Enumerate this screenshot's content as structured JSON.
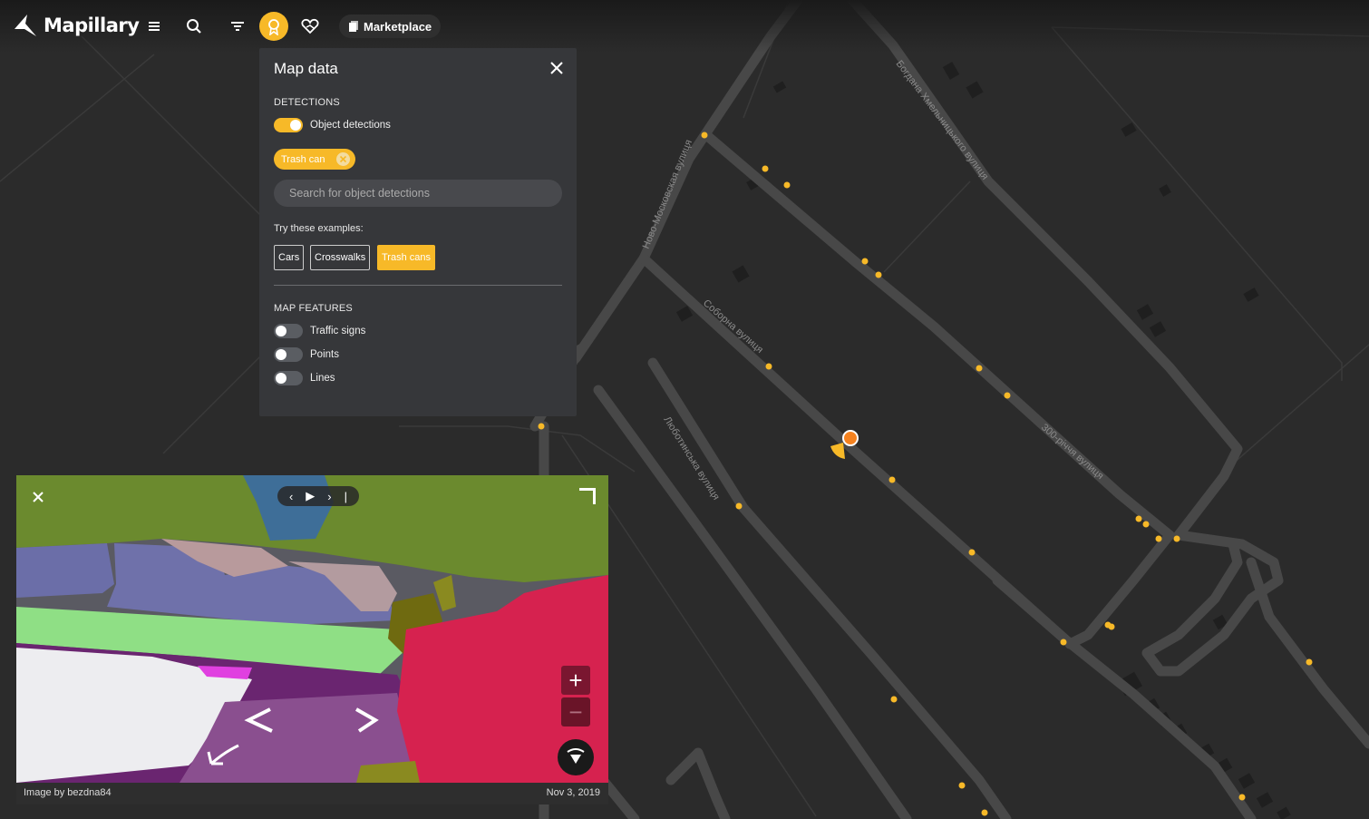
{
  "app": {
    "name": "Mapillary"
  },
  "toolbar": {
    "marketplace_label": "Marketplace"
  },
  "panel": {
    "title": "Map data",
    "detections_label": "DETECTIONS",
    "object_detections_label": "Object detections",
    "object_detections_on": true,
    "chip_label": "Trash can",
    "search_placeholder": "Search for object detections",
    "try_label": "Try these examples:",
    "examples": [
      "Cars",
      "Crosswalks",
      "Trash cans"
    ],
    "active_example": "Trash cans",
    "map_features_label": "MAP FEATURES",
    "features": [
      {
        "label": "Traffic signs",
        "on": false
      },
      {
        "label": "Points",
        "on": false
      },
      {
        "label": "Lines",
        "on": false
      }
    ]
  },
  "map": {
    "street_labels": [
      "Ново-Московская вулиця",
      "Богдана Хмельницького вулиця",
      "Соборна вулиця",
      "Люботинська вулиця",
      "300-річчя вулиця"
    ]
  },
  "viewer": {
    "credit": "Image by bezdna84",
    "date": "Nov 3, 2019",
    "zoom_in": "+",
    "zoom_out": "−"
  },
  "colors": {
    "accent": "#f7b928",
    "marker": "#f5821f",
    "map_bg": "#2b2b2b",
    "road": "#4a4a4a",
    "panel_bg": "#36373a"
  }
}
